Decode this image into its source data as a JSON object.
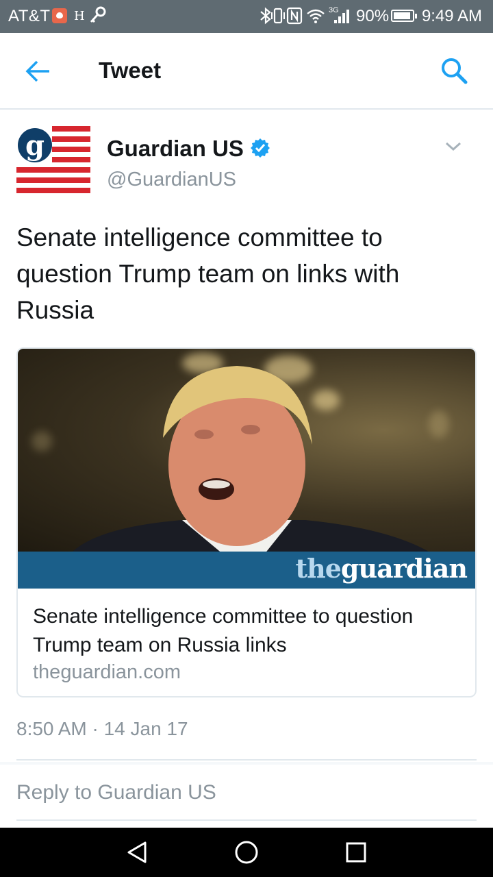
{
  "status_bar": {
    "carrier": "AT&T",
    "network_letter": "H",
    "network_type": "3G",
    "battery": "90%",
    "time": "9:49 AM",
    "icons": [
      "notification-icon",
      "key-icon",
      "bluetooth-icon",
      "vibrate-icon",
      "nfc-icon",
      "wifi-icon",
      "signal-icon",
      "battery-icon"
    ]
  },
  "header": {
    "title": "Tweet",
    "back_icon": "arrow-left-icon",
    "search_icon": "search-icon",
    "accent_color": "#1da1f2"
  },
  "tweet": {
    "author_name": "Guardian US",
    "author_handle": "@GuardianUS",
    "verified": true,
    "text": "Senate intelligence committee to question Trump team on links with Russia",
    "timestamp": "8:50 AM · 14 Jan 17",
    "card": {
      "brand_prefix": "the",
      "brand_name": "guardian",
      "title": "Senate intelligence committee to question Trump team on Russia links",
      "domain": "theguardian.com"
    }
  },
  "reply": {
    "placeholder": "Reply to Guardian US"
  },
  "nav_bar": {
    "buttons": [
      "back-triangle-icon",
      "home-circle-icon",
      "recents-square-icon"
    ]
  }
}
